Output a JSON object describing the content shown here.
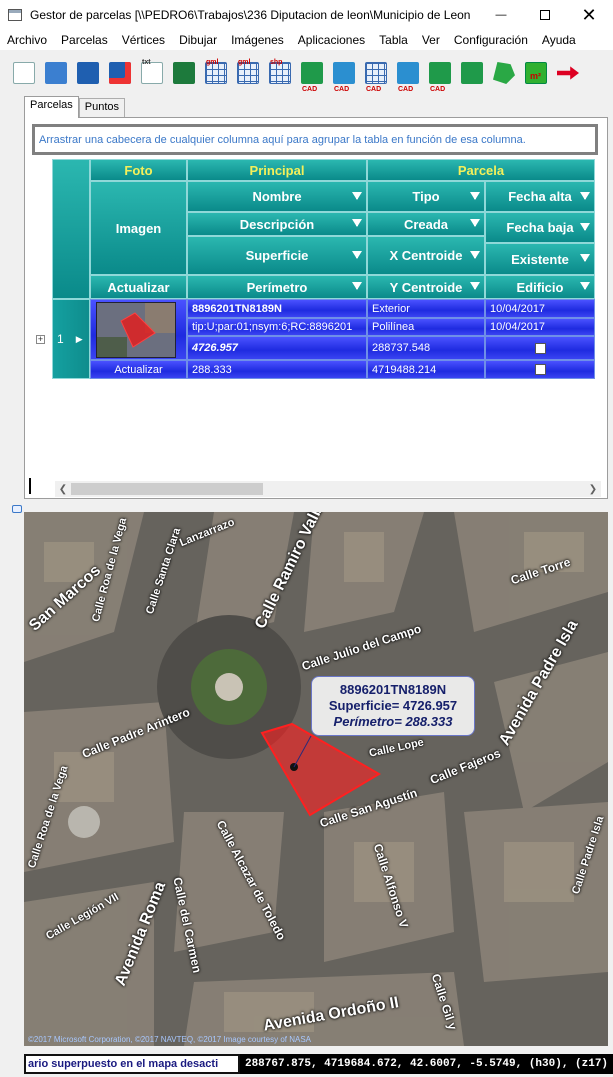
{
  "window": {
    "title": "Gestor de parcelas [\\\\PEDRO6\\Trabajos\\236 Diputacion de leon\\Municipio de Leon...",
    "close_glyph": "✕",
    "min_glyph": "—"
  },
  "menu": [
    "Archivo",
    "Parcelas",
    "Vértices",
    "Dibujar",
    "Imágenes",
    "Aplicaciones",
    "Tabla",
    "Ver",
    "Configuración",
    "Ayuda"
  ],
  "toolbar": {
    "icons": [
      "new-document-icon",
      "open-folder-icon",
      "save-icon",
      "save-as-icon",
      "export-txt-icon",
      "export-excel-icon",
      "grid-gml-icon",
      "grid-gml-2-icon",
      "grid-shp-icon",
      "parcel-cad-icon",
      "globe-cad-icon",
      "import-cad-icon",
      "export-cad-icon",
      "search-cad-icon",
      "measure-icon",
      "polygon-icon",
      "area-m2-icon",
      "next-icon"
    ],
    "small_labels": {
      "txt": "txt",
      "gml": "gml",
      "shp": "shp",
      "cad": "CAD",
      "m2": "m²"
    }
  },
  "tabs": [
    "Parcelas",
    "Puntos"
  ],
  "grid": {
    "group_hint": "Arrastrar una cabecera de cualquier columna aquí para agrupar la tabla en función de esa columna.",
    "bands": {
      "foto": "Foto",
      "principal": "Principal",
      "parcela": "Parcela"
    },
    "columns": {
      "imagen": "Imagen",
      "actualizar": "Actualizar",
      "nombre": "Nombre",
      "descripcion": "Descripción",
      "superficie": "Superficie",
      "perimetro": "Perímetro",
      "tipo": "Tipo",
      "creada": "Creada",
      "x_centroide": "X Centroide",
      "y_centroide": "Y Centroide",
      "fecha_alta": "Fecha alta",
      "fecha_baja": "Fecha baja",
      "existente": "Existente",
      "edificio": "Edificio"
    },
    "rows": [
      {
        "index": "1",
        "expand": "+",
        "nombre": "8896201TN8189N",
        "descripcion": "tip:U;par:01;nsym:6;RC:8896201",
        "superficie": "4726.957",
        "perimetro": "288.333",
        "tipo": "Exterior",
        "creada": "Polilínea",
        "x_centroide": "288737.548",
        "y_centroide": "4719488.214",
        "fecha_alta": "10/04/2017",
        "fecha_baja": "10/04/2017",
        "existente": false,
        "edificio": false,
        "actualizar": "Actualizar"
      }
    ]
  },
  "map": {
    "popup": {
      "name": "8896201TN8189N",
      "superficie": "Superficie= 4726.957",
      "perimetro": "Perímetro= 288.333"
    },
    "streets": [
      "Calle Ramiro Valbuena",
      "Avenida Padre Isla",
      "Calle Julio del Campo",
      "Calle Torre",
      "Calle Roa de la Vega",
      "Calle Padre Arintero",
      "Calle San Agustín",
      "Calle Alcázar de Toledo",
      "Calle del Carmen",
      "Avenida Roma",
      "Calle Alfonso V",
      "Avenida Ordoño II",
      "Calle Gil y Carrasco",
      "Calle Fajeros",
      "Calle Santa Clara",
      "San Marcos",
      "Calle Lope",
      "Calle Roa de la Vega 2",
      "Calle Padre Isla",
      "Lanzarrazo",
      "Calle Legión VII"
    ],
    "street_display": {
      "s0": "Calle Ramiro Valbuena",
      "s1": "Avenida Padre Isla",
      "s2": "Calle Julio del Campo",
      "s3": "Calle Torre",
      "s4": "Calle Roa de la Vega",
      "s5": "Calle Padre Arintero",
      "s6": "Calle San Agustín",
      "s7": "Calle Alcazar de Toledo",
      "s8": "Calle del Carmen",
      "s9": "Avenida Roma",
      "s10": "Calle Alfonso V",
      "s11": "Avenida Ordoño II",
      "s12": "Calle Gil y",
      "s13": "Calle Fajeros",
      "s14": "Calle Santa Clara",
      "s15": "San Marcos",
      "s16": "Calle Lope",
      "s17": "Calle Roa de la Vega",
      "s18": "Calle Padre Isla",
      "s19": "Lanzarrazo",
      "s20": "Calle Legión VII"
    },
    "copyright": "©2017 Microsoft Corporation, ©2017 NAVTEQ, ©2017 Image courtesy of NASA",
    "parcel_color": "#ff2020"
  },
  "status": {
    "message": "ario superpuesto en el mapa desacti",
    "coords": "288767.875, 4719684.672, 42.6007, -5.5749, (h30), (z17)"
  }
}
